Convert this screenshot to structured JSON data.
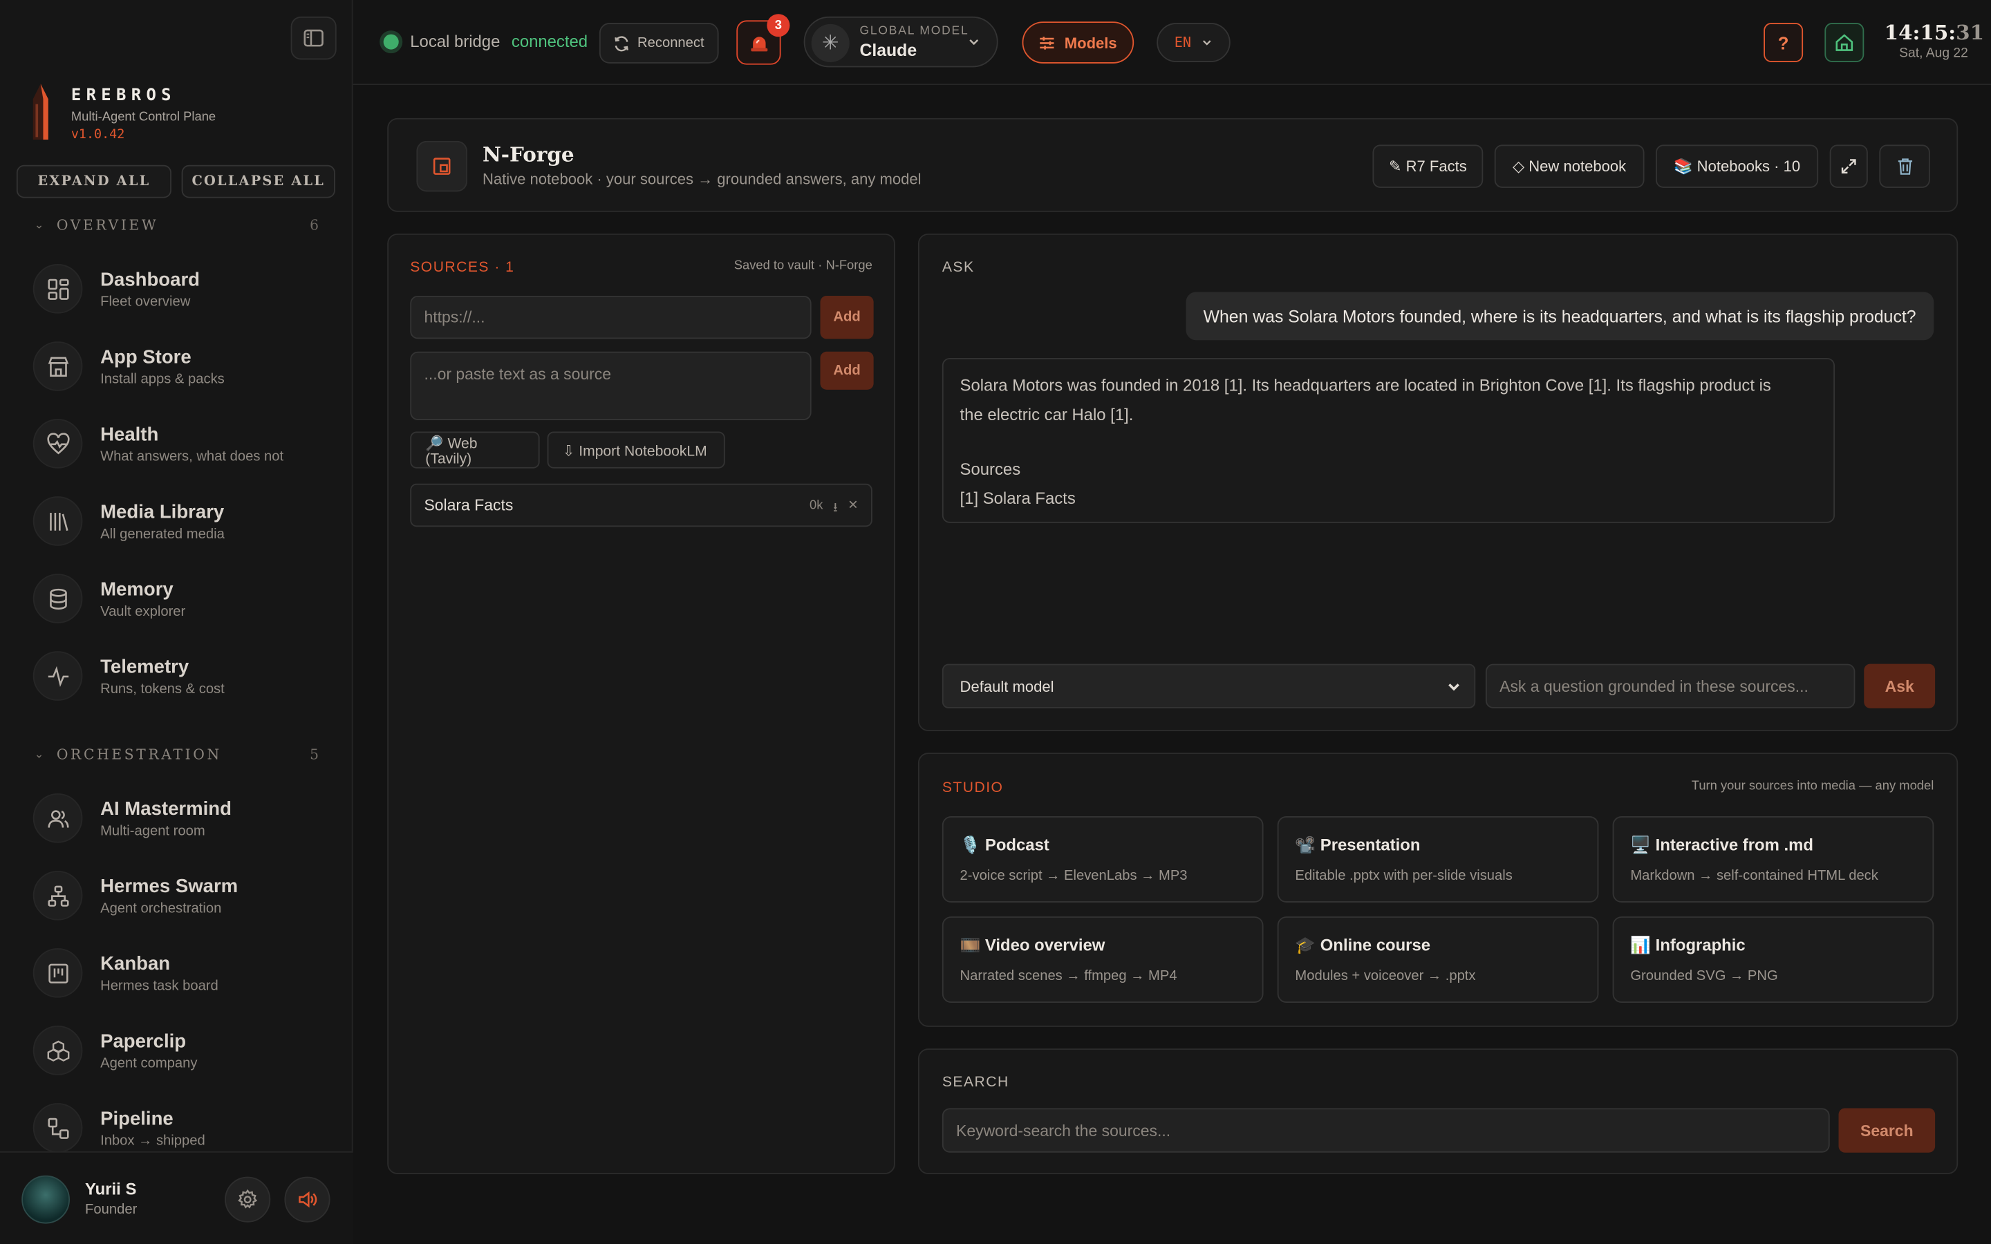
{
  "brand": {
    "name": "EREBROS",
    "subtitle": "Multi-Agent Control Plane",
    "version": "v1.0.42"
  },
  "sidebar": {
    "expand_all": "EXPAND ALL",
    "collapse_all": "COLLAPSE ALL",
    "sections": [
      {
        "title": "OVERVIEW",
        "count": "6",
        "items": [
          {
            "label": "Dashboard",
            "sub": "Fleet overview",
            "icon": "grid-icon"
          },
          {
            "label": "App Store",
            "sub": "Install apps & packs",
            "icon": "store-icon"
          },
          {
            "label": "Health",
            "sub": "What answers, what does not",
            "icon": "heart-pulse-icon"
          },
          {
            "label": "Media Library",
            "sub": "All generated media",
            "icon": "library-icon"
          },
          {
            "label": "Memory",
            "sub": "Vault explorer",
            "icon": "database-icon"
          },
          {
            "label": "Telemetry",
            "sub": "Runs, tokens & cost",
            "icon": "activity-icon"
          }
        ]
      },
      {
        "title": "ORCHESTRATION",
        "count": "5",
        "items": [
          {
            "label": "AI Mastermind",
            "sub": "Multi-agent room",
            "icon": "users-icon"
          },
          {
            "label": "Hermes Swarm",
            "sub": "Agent orchestration",
            "icon": "network-icon"
          },
          {
            "label": "Kanban",
            "sub": "Hermes task board",
            "icon": "kanban-icon"
          },
          {
            "label": "Paperclip",
            "sub": "Agent company",
            "icon": "boxes-icon"
          },
          {
            "label": "Pipeline",
            "sub": "Inbox → shipped",
            "icon": "workflow-icon"
          }
        ]
      }
    ],
    "user": {
      "name": "Yurii S",
      "role": "Founder"
    }
  },
  "topbar": {
    "bridge_label": "Local bridge",
    "bridge_status": "connected",
    "reconnect": "Reconnect",
    "alert_count": "3",
    "global_model_label": "GLOBAL MODEL",
    "global_model": "Claude",
    "models": "Models",
    "lang": "EN",
    "help": "?",
    "time_hm": "14:15:",
    "time_s": "31",
    "date": "Sat, Aug 22"
  },
  "notebook": {
    "title": "N-Forge",
    "subtitle": "Native notebook · your sources → grounded answers, any model",
    "btn_facts": "✎ R7 Facts",
    "btn_new": "◇ New notebook",
    "btn_notebooks": "📚 Notebooks · 10"
  },
  "sources": {
    "title": "SOURCES · 1",
    "saved": "Saved to vault · N-Forge",
    "url_placeholder": "https://...",
    "text_placeholder": "...or paste text as a source",
    "add": "Add",
    "web": "🔎 Web (Tavily)",
    "import": "⇩ Import NotebookLM",
    "items": [
      {
        "name": "Solara Facts",
        "size": "0k"
      }
    ]
  },
  "ask": {
    "title": "ASK",
    "question": "When was Solara Motors founded, where is its headquarters, and what is its flagship product?",
    "answer_line1": "Solara Motors was founded in 2018 [1]. Its headquarters are located in Brighton Cove [1]. Its flagship product is",
    "answer_line2": "the electric car Halo [1].",
    "sources_label": "Sources",
    "source_ref": "[1] Solara Facts",
    "model_select": "Default model",
    "input_placeholder": "Ask a question grounded in these sources...",
    "ask_btn": "Ask"
  },
  "studio": {
    "title": "STUDIO",
    "tagline": "Turn your sources into media — any model",
    "tiles": [
      {
        "title": "🎙️ Podcast",
        "desc": "2-voice script → ElevenLabs → MP3"
      },
      {
        "title": "📽️ Presentation",
        "desc": "Editable .pptx with per-slide visuals"
      },
      {
        "title": "🖥️ Interactive from .md",
        "desc": "Markdown → self-contained HTML deck"
      },
      {
        "title": "🎞️ Video overview",
        "desc": "Narrated scenes → ffmpeg → MP4"
      },
      {
        "title": "🎓 Online course",
        "desc": "Modules + voiceover → .pptx"
      },
      {
        "title": "📊 Infographic",
        "desc": "Grounded SVG → PNG"
      }
    ]
  },
  "search": {
    "title": "SEARCH",
    "placeholder": "Keyword-search the sources...",
    "button": "Search"
  },
  "colors": {
    "accent": "#e0562e",
    "ok": "#4fc37e",
    "bg": "#131313",
    "panel": "#181818"
  }
}
